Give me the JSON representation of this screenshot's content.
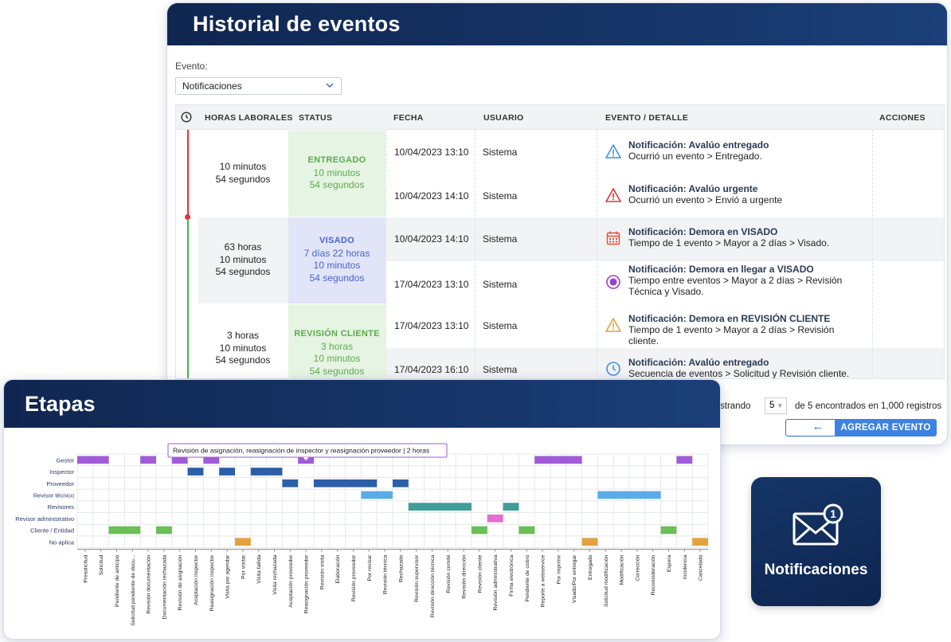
{
  "historial": {
    "title": "Historial de eventos",
    "evento_label": "Evento:",
    "evento_value": "Notificaciones",
    "columns": [
      "HORAS LABORALES",
      "STATUS",
      "FECHA",
      "USUARIO",
      "EVENTO / DETALLE",
      "ACCIONES"
    ],
    "groups": [
      {
        "hours": [
          "10 minutos",
          "54 segundos"
        ],
        "status": "ENTREGADO",
        "status_time": [
          "10 minutos",
          "54 segundos"
        ],
        "status_color": "green"
      },
      {
        "hours": [
          "63 horas",
          "10 minutos",
          "54 segundos"
        ],
        "status": "VISADO",
        "status_time": [
          "7 días 22 horas",
          "10 minutos",
          "54 segundos"
        ],
        "status_color": "blue"
      },
      {
        "hours": [
          "3 horas",
          "10 minutos",
          "54 segundos"
        ],
        "status": "REVISIÓN CLIENTE",
        "status_time": [
          "3 horas",
          "10 minutos",
          "54 segundos"
        ],
        "status_color": "green"
      }
    ],
    "rows": [
      {
        "fecha": "10/04/2023 13:10",
        "usuario": "Sistema",
        "icon": "info-triangle-icon",
        "title": "Notificación: Avalúo entregado",
        "desc": "Ocurrió un evento > Entregado."
      },
      {
        "fecha": "10/04/2023 14:10",
        "usuario": "Sistema",
        "icon": "warning-red-icon",
        "title": "Notificación: Avalúo urgente",
        "desc": "Ocurrió un evento > Envió a urgente"
      },
      {
        "fecha": "10/04/2023 14:10",
        "usuario": "Sistema",
        "icon": "calendar-icon",
        "title": "Notificación: Demora en VISADO",
        "desc": "Tiempo de 1 evento > Mayor a 2 días > Visado."
      },
      {
        "fecha": "17/04/2023 13:10",
        "usuario": "Sistema",
        "icon": "radio-circle-icon",
        "title": "Notificación: Demora en llegar a VISADO",
        "desc": "Tiempo entre eventos > Mayor a 2 días > Revisión Técnica y Visado."
      },
      {
        "fecha": "17/04/2023 13:10",
        "usuario": "Sistema",
        "icon": "warning-orange-icon",
        "title": "Notificación: Demora en REVISIÓN CLIENTE",
        "desc": "Tiempo de 1 evento > Mayor a 2 días > Revisión cliente."
      },
      {
        "fecha": "17/04/2023 16:10",
        "usuario": "Sistema",
        "icon": "clock-icon",
        "title": "Notificación: Avalúo entregado",
        "desc": "Secuencia de eventos > Solicitud y Revisión cliente."
      }
    ],
    "pagination": {
      "showing_label": "strando",
      "page_size": "5",
      "summary": "de 5 encontrados en 1,000 registros"
    },
    "back_icon": "arrow-left-icon",
    "add_button": "AGREGAR EVENTO"
  },
  "etapas": {
    "title": "Etapas",
    "tooltip": "Revisión de asignación, reasignación de inspector y reasignación proveedor | 2 horas"
  },
  "notificaciones": {
    "label": "Notificaciones",
    "badge": "1",
    "icon": "envelope-icon"
  },
  "chart_data": {
    "type": "heatmap",
    "rows": [
      "Gestor",
      "Inspector",
      "Proveedor",
      "Revisor técnico",
      "Revisores",
      "Revisor administrativo",
      "Cliente / Entidad",
      "No aplica"
    ],
    "columns": [
      "Presolicitud",
      "Solicitud",
      "Pendiente de anticipo",
      "Solicitud pendiente de docu...",
      "Revisión documentación",
      "Documentación rechazada",
      "Revisión de asignación",
      "Aceptación inspector",
      "Reasignación inspector",
      "Visita por agendar",
      "Por visitar",
      "Visita fallida",
      "Visita rechazada",
      "Aceptación proveedor",
      "Reasignación proveedor",
      "Revisión visita",
      "Elaboración",
      "Revisión proveedor",
      "Por revisar",
      "Revisión técnica",
      "Rechazado",
      "Revisión supervisor",
      "Revisión dirección técnica",
      "Revisión comité",
      "Revisión dirección",
      "Revisión cliente",
      "Revisión administrativa",
      "Firma electrónica",
      "Pendiente de cobro",
      "Reporte a webservice",
      "Por imprimir",
      "Visado/Por entregar",
      "Entregado",
      "Solicitud modificación",
      "Modificación",
      "Corrección",
      "Reconsideración",
      "Espera",
      "Incidencia",
      "Cancelado"
    ],
    "cells": [
      {
        "row": 0,
        "start": 0,
        "end": 1,
        "color": "#a15bd6"
      },
      {
        "row": 0,
        "start": 4,
        "end": 4,
        "color": "#a15bd6"
      },
      {
        "row": 0,
        "start": 6,
        "end": 6,
        "color": "#a15bd6"
      },
      {
        "row": 0,
        "start": 8,
        "end": 8,
        "color": "#a15bd6"
      },
      {
        "row": 0,
        "start": 14,
        "end": 14,
        "color": "#a15bd6"
      },
      {
        "row": 0,
        "start": 29,
        "end": 31,
        "color": "#a15bd6"
      },
      {
        "row": 0,
        "start": 38,
        "end": 38,
        "color": "#a15bd6"
      },
      {
        "row": 1,
        "start": 7,
        "end": 7,
        "color": "#2d5ea8"
      },
      {
        "row": 1,
        "start": 9,
        "end": 9,
        "color": "#2d5ea8"
      },
      {
        "row": 1,
        "start": 11,
        "end": 12,
        "color": "#2d5ea8"
      },
      {
        "row": 2,
        "start": 13,
        "end": 13,
        "color": "#2d5ea8"
      },
      {
        "row": 2,
        "start": 15,
        "end": 18,
        "color": "#2d5ea8"
      },
      {
        "row": 2,
        "start": 20,
        "end": 20,
        "color": "#2d5ea8"
      },
      {
        "row": 3,
        "start": 18,
        "end": 19,
        "color": "#5aace8"
      },
      {
        "row": 3,
        "start": 33,
        "end": 36,
        "color": "#5aace8"
      },
      {
        "row": 4,
        "start": 21,
        "end": 24,
        "color": "#3f9e9a"
      },
      {
        "row": 4,
        "start": 27,
        "end": 27,
        "color": "#3f9e9a"
      },
      {
        "row": 5,
        "start": 26,
        "end": 26,
        "color": "#e36fd0"
      },
      {
        "row": 6,
        "start": 2,
        "end": 3,
        "color": "#6abf57"
      },
      {
        "row": 6,
        "start": 5,
        "end": 5,
        "color": "#6abf57"
      },
      {
        "row": 6,
        "start": 25,
        "end": 25,
        "color": "#6abf57"
      },
      {
        "row": 6,
        "start": 28,
        "end": 28,
        "color": "#6abf57"
      },
      {
        "row": 6,
        "start": 37,
        "end": 37,
        "color": "#6abf57"
      },
      {
        "row": 7,
        "start": 10,
        "end": 10,
        "color": "#e3a23c"
      },
      {
        "row": 7,
        "start": 32,
        "end": 32,
        "color": "#e3a23c"
      },
      {
        "row": 7,
        "start": 39,
        "end": 39,
        "color": "#e3a23c"
      }
    ]
  }
}
